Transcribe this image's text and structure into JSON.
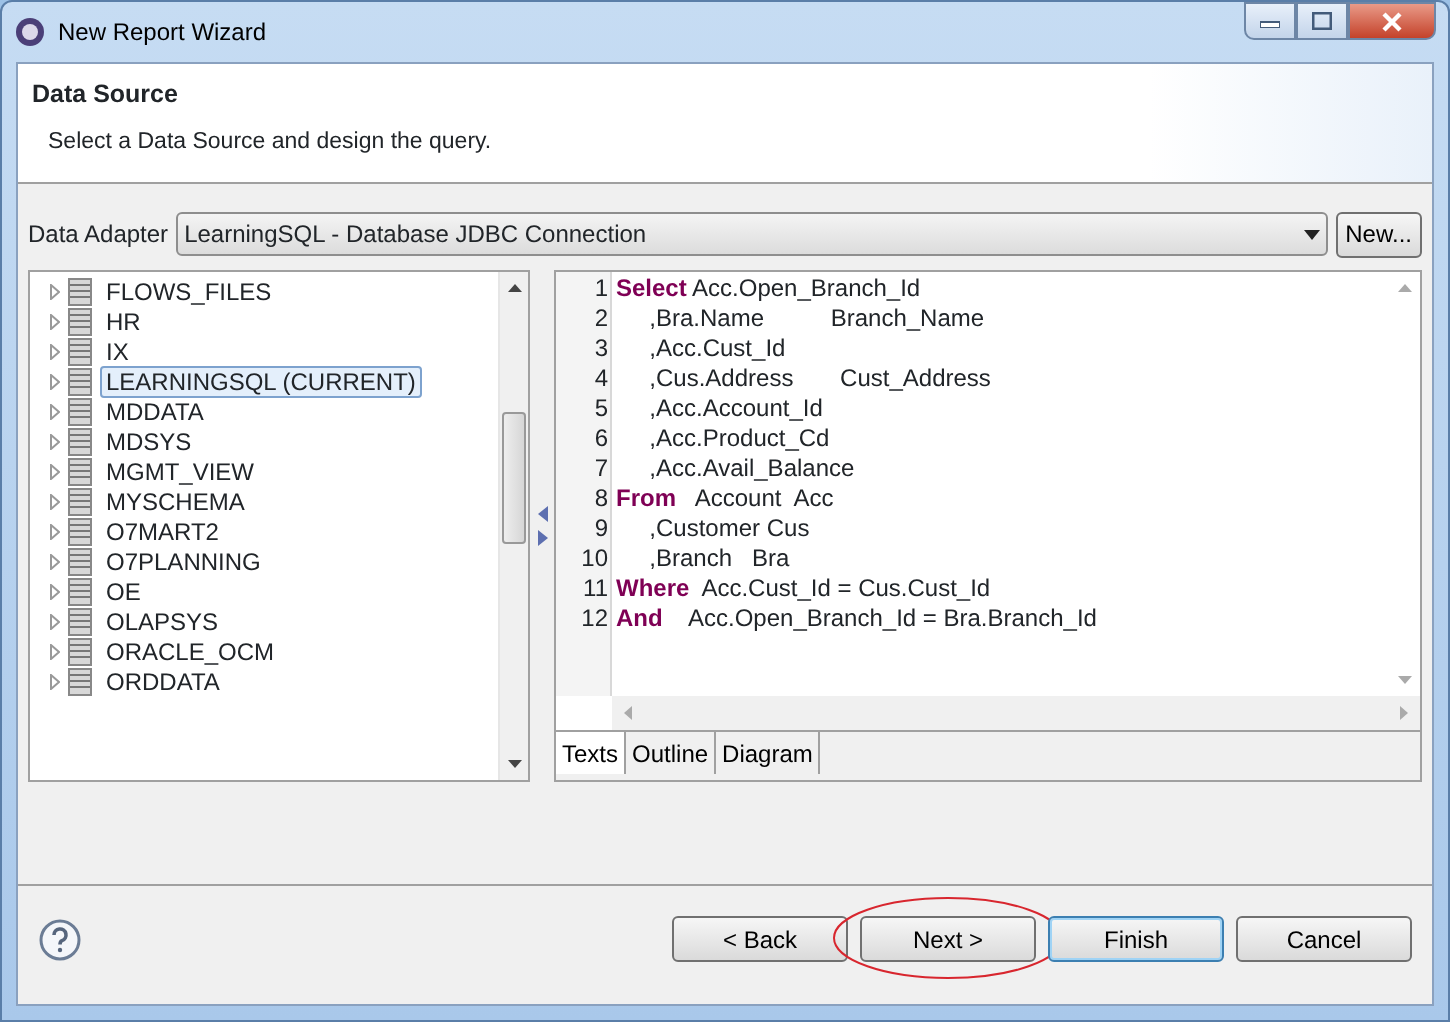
{
  "window": {
    "title": "New Report Wizard"
  },
  "header": {
    "title": "Data Source",
    "description": "Select a Data Source and design the query."
  },
  "adapter": {
    "label": "Data Adapter",
    "value": "LearningSQL - Database JDBC Connection",
    "new_button": "New..."
  },
  "schemas": [
    {
      "name": "FLOWS_FILES",
      "selected": false
    },
    {
      "name": "HR",
      "selected": false
    },
    {
      "name": "IX",
      "selected": false
    },
    {
      "name": "LEARNINGSQL (CURRENT)",
      "selected": true
    },
    {
      "name": "MDDATA",
      "selected": false
    },
    {
      "name": "MDSYS",
      "selected": false
    },
    {
      "name": "MGMT_VIEW",
      "selected": false
    },
    {
      "name": "MYSCHEMA",
      "selected": false
    },
    {
      "name": "O7MART2",
      "selected": false
    },
    {
      "name": "O7PLANNING",
      "selected": false
    },
    {
      "name": "OE",
      "selected": false
    },
    {
      "name": "OLAPSYS",
      "selected": false
    },
    {
      "name": "ORACLE_OCM",
      "selected": false
    },
    {
      "name": "ORDDATA",
      "selected": false
    }
  ],
  "query_lines": [
    {
      "number": "1",
      "keyword": "Select",
      "text": " Acc.Open_Branch_Id"
    },
    {
      "number": "2",
      "text": "     ,Bra.Name          Branch_Name"
    },
    {
      "number": "3",
      "text": "     ,Acc.Cust_Id"
    },
    {
      "number": "4",
      "text": "     ,Cus.Address       Cust_Address"
    },
    {
      "number": "5",
      "text": "     ,Acc.Account_Id"
    },
    {
      "number": "6",
      "text": "     ,Acc.Product_Cd"
    },
    {
      "number": "7",
      "text": "     ,Acc.Avail_Balance"
    },
    {
      "number": "8",
      "keyword": "From",
      "text": "   Account  Acc"
    },
    {
      "number": "9",
      "text": "     ,Customer Cus"
    },
    {
      "number": "10",
      "text": "     ,Branch   Bra"
    },
    {
      "number": "11",
      "keyword": "Where",
      "text": "  Acc.Cust_Id = Cus.Cust_Id"
    },
    {
      "number": "12",
      "keyword": "And",
      "text": "    Acc.Open_Branch_Id = Bra.Branch_Id"
    }
  ],
  "editor_tabs": [
    {
      "label": "Texts",
      "selected": true
    },
    {
      "label": "Outline",
      "selected": false
    },
    {
      "label": "Diagram",
      "selected": false
    }
  ],
  "buttons": [
    {
      "label": "< Back",
      "default": false,
      "circled": false
    },
    {
      "label": "Next >",
      "default": false,
      "circled": true
    },
    {
      "label": "Finish",
      "default": true,
      "circled": false
    },
    {
      "label": "Cancel",
      "default": false,
      "circled": false
    }
  ]
}
